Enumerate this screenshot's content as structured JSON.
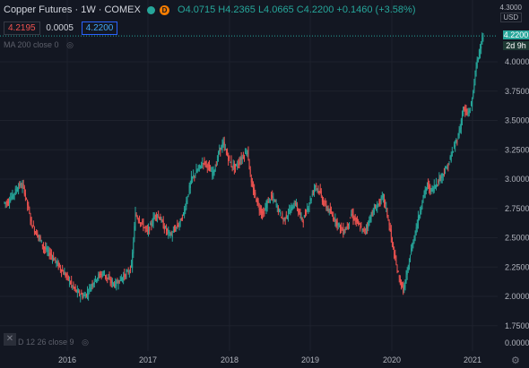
{
  "legend": {
    "symbol": "Copper Futures · 1W · COMEX",
    "badge": "D",
    "open": "O4.0715",
    "high": "H4.2365",
    "low": "L4.0665",
    "close": "C4.2200",
    "change": "+0.1460 (+3.58%)",
    "bid": "4.2195",
    "spread": "0.0005",
    "ask": "4.2200"
  },
  "indicators": {
    "ma": "MA 200 close 0",
    "macd": "D 12 26 close 9"
  },
  "axis": {
    "unit_top": "4.3000",
    "unit": "USD",
    "last_price": "4.2200",
    "countdown": "2d 9h"
  },
  "colors": {
    "up": "#26a69a",
    "down": "#ef5350",
    "background": "#131722",
    "grid": "#1e222d"
  },
  "chart_data": {
    "type": "candlestick",
    "y_ticks": [
      "4.0000",
      "3.7500",
      "3.5000",
      "3.2500",
      "3.0000",
      "2.7500",
      "2.5000",
      "2.2500",
      "2.0000",
      "1.7500",
      "0.0000"
    ],
    "x_ticks": [
      "2016",
      "2017",
      "2018",
      "2019",
      "2020",
      "2021"
    ],
    "closes": [
      2.8,
      2.85,
      2.9,
      2.95,
      2.93,
      2.78,
      2.62,
      2.55,
      2.5,
      2.42,
      2.38,
      2.35,
      2.3,
      2.25,
      2.2,
      2.16,
      2.1,
      2.05,
      2.02,
      2.0,
      2.03,
      2.1,
      2.15,
      2.18,
      2.2,
      2.15,
      2.12,
      2.1,
      2.14,
      2.17,
      2.2,
      2.25,
      2.7,
      2.65,
      2.6,
      2.55,
      2.62,
      2.7,
      2.68,
      2.6,
      2.55,
      2.52,
      2.58,
      2.62,
      2.7,
      2.85,
      3.0,
      3.05,
      3.1,
      3.15,
      3.12,
      3.05,
      3.1,
      3.25,
      3.3,
      3.2,
      3.12,
      3.1,
      3.15,
      3.2,
      3.25,
      2.95,
      2.85,
      2.75,
      2.7,
      2.8,
      2.85,
      2.8,
      2.72,
      2.65,
      2.7,
      2.75,
      2.8,
      2.7,
      2.65,
      2.75,
      2.85,
      2.95,
      2.9,
      2.8,
      2.75,
      2.7,
      2.65,
      2.6,
      2.55,
      2.6,
      2.7,
      2.65,
      2.6,
      2.55,
      2.6,
      2.7,
      2.75,
      2.8,
      2.85,
      2.7,
      2.5,
      2.3,
      2.15,
      2.05,
      2.2,
      2.4,
      2.55,
      2.7,
      2.85,
      2.95,
      2.9,
      2.95,
      3.0,
      3.05,
      3.1,
      3.2,
      3.3,
      3.4,
      3.6,
      3.55,
      3.62,
      3.9,
      4.1,
      4.22
    ]
  }
}
